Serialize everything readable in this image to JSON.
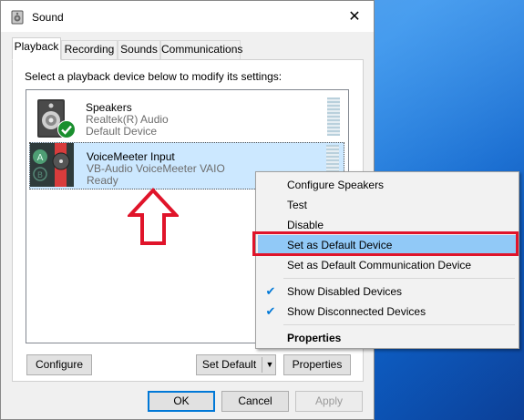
{
  "window": {
    "title": "Sound",
    "close_label": "✕"
  },
  "tabs": [
    {
      "label": "Playback",
      "active": true
    },
    {
      "label": "Recording",
      "active": false
    },
    {
      "label": "Sounds",
      "active": false
    },
    {
      "label": "Communications",
      "active": false
    }
  ],
  "instructions": "Select a playback device below to modify its settings:",
  "devices": [
    {
      "name": "Speakers",
      "driver": "Realtek(R) Audio",
      "status": "Default Device",
      "icon": "speaker-icon",
      "badge": "default-checkmark-icon"
    },
    {
      "name": "VoiceMeeter Input",
      "driver": "VB-Audio VoiceMeeter VAIO",
      "status": "Ready",
      "icon": "voicemeeter-icon",
      "selected": true
    }
  ],
  "buttons": {
    "configure": "Configure",
    "set_default": "Set Default",
    "properties": "Properties",
    "ok": "OK",
    "cancel": "Cancel",
    "apply": "Apply"
  },
  "context_menu": {
    "items": [
      {
        "label": "Configure Speakers"
      },
      {
        "label": "Test"
      },
      {
        "label": "Disable"
      },
      {
        "label": "Set as Default Device",
        "highlighted": true
      },
      {
        "label": "Set as Default Communication Device"
      },
      {
        "label": "Show Disabled Devices",
        "checked": true
      },
      {
        "label": "Show Disconnected Devices",
        "checked": true
      },
      {
        "label": "Properties",
        "bold": true
      }
    ]
  },
  "colors": {
    "selection": "#cce8ff",
    "menu_highlight": "#91c9f7",
    "annotation_red": "#e0142a",
    "accent": "#0078d7"
  }
}
